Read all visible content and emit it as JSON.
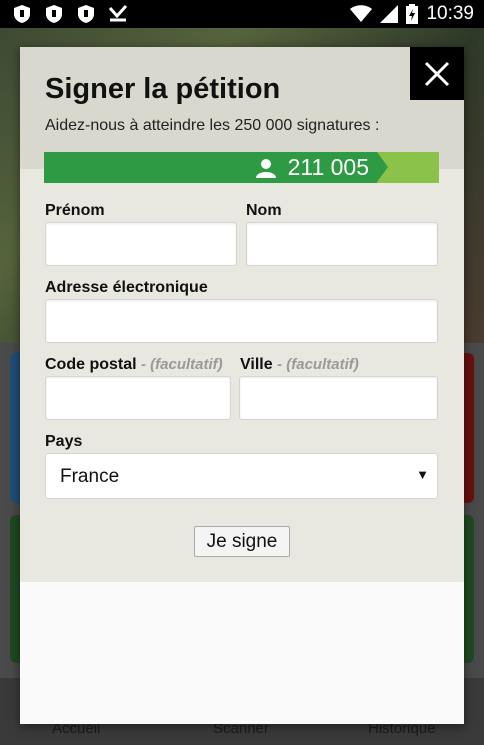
{
  "status_bar": {
    "left_icons": [
      "shield-icon",
      "shield-icon",
      "shield-icon",
      "check-icon"
    ],
    "right_icons": [
      "wifi-icon",
      "signal-icon",
      "battery-icon"
    ],
    "time": "10:39"
  },
  "background": {
    "nav": [
      "Accueil",
      "Scanner",
      "Historique"
    ]
  },
  "modal": {
    "title": "Signer la pétition",
    "subtitle": "Aidez-nous à atteindre les 250 000 signatures :",
    "close_icon": "close-icon",
    "progress": {
      "count": "211 005",
      "current": 211005,
      "goal": 250000,
      "icon": "user-icon",
      "colors": {
        "filled": "#2e9a43",
        "remaining": "#8bc34a"
      }
    },
    "fields": {
      "first_name_label": "Prénom",
      "last_name_label": "Nom",
      "email_label": "Adresse électronique",
      "postal_label": "Code postal",
      "postal_optional": "- (facultatif)",
      "city_label": "Ville",
      "city_optional": "- (facultatif)",
      "country_label": "Pays",
      "country_value": "France"
    },
    "submit_label": "Je signe"
  }
}
